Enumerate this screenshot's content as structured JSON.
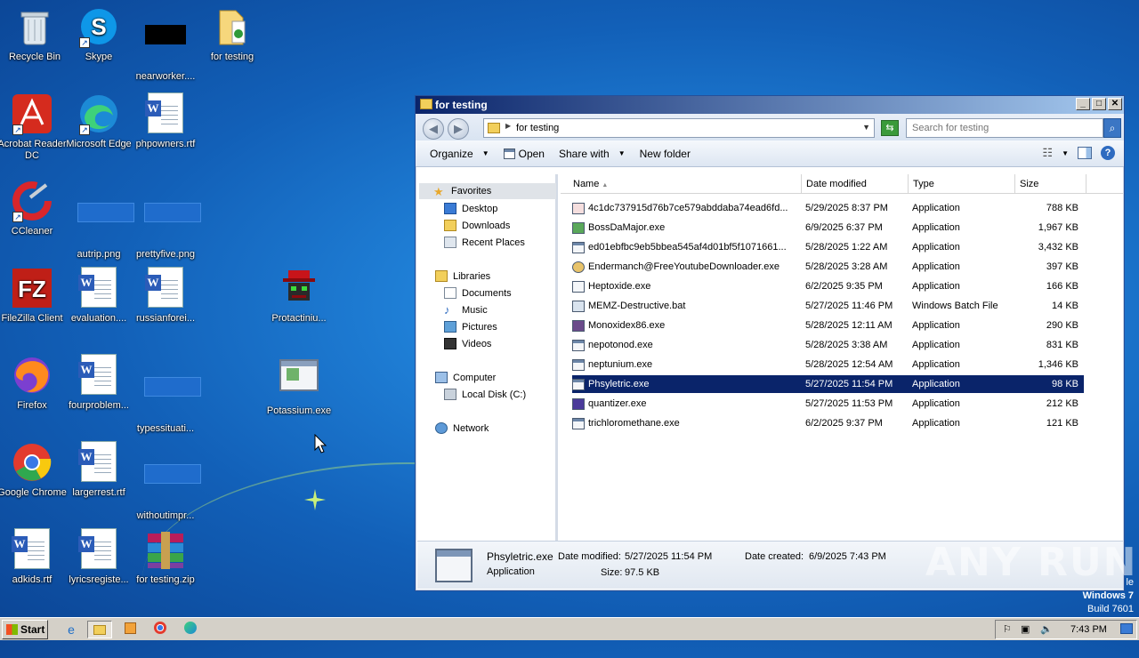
{
  "desktop": {
    "icons": [
      {
        "label": "Recycle Bin"
      },
      {
        "label": "Skype"
      },
      {
        "label": "nearworker...."
      },
      {
        "label": "for testing"
      },
      {
        "label": "Acrobat Reader DC"
      },
      {
        "label": "Microsoft Edge"
      },
      {
        "label": "phpowners.rtf"
      },
      {
        "label": "CCleaner"
      },
      {
        "label": "autrip.png"
      },
      {
        "label": "prettyfive.png"
      },
      {
        "label": "FileZilla Client"
      },
      {
        "label": "evaluation...."
      },
      {
        "label": "russianforei..."
      },
      {
        "label": "Protactiniu..."
      },
      {
        "label": "Firefox"
      },
      {
        "label": "fourproblem..."
      },
      {
        "label": "typessituati..."
      },
      {
        "label": "Potassium.exe"
      },
      {
        "label": "Google Chrome"
      },
      {
        "label": "largerrest.rtf"
      },
      {
        "label": "withoutimpr..."
      },
      {
        "label": "adkids.rtf"
      },
      {
        "label": "lyricsregiste..."
      },
      {
        "label": "for testing.zip"
      }
    ]
  },
  "window": {
    "title": "for testing",
    "address": "for testing",
    "search_placeholder": "Search for testing",
    "toolbar": {
      "organize": "Organize",
      "open": "Open",
      "share": "Share with",
      "new_folder": "New folder"
    },
    "nav": {
      "favorites": "Favorites",
      "desktop": "Desktop",
      "downloads": "Downloads",
      "recent": "Recent Places",
      "libraries": "Libraries",
      "documents": "Documents",
      "music": "Music",
      "pictures": "Pictures",
      "videos": "Videos",
      "computer": "Computer",
      "local_disk": "Local Disk (C:)",
      "network": "Network"
    },
    "columns": {
      "name": "Name",
      "date": "Date modified",
      "type": "Type",
      "size": "Size"
    },
    "files": [
      {
        "name": "4c1dc737915d76b7ce579abddaba74ead6fd...",
        "date": "5/29/2025 8:37 PM",
        "type": "Application",
        "size": "788 KB"
      },
      {
        "name": "BossDaMajor.exe",
        "date": "6/9/2025 6:37 PM",
        "type": "Application",
        "size": "1,967 KB"
      },
      {
        "name": "ed01ebfbc9eb5bbea545af4d01bf5f1071661...",
        "date": "5/28/2025 1:22 AM",
        "type": "Application",
        "size": "3,432 KB"
      },
      {
        "name": "Endermanch@FreeYoutubeDownloader.exe",
        "date": "5/28/2025 3:28 AM",
        "type": "Application",
        "size": "397 KB"
      },
      {
        "name": "Heptoxide.exe",
        "date": "6/2/2025 9:35 PM",
        "type": "Application",
        "size": "166 KB"
      },
      {
        "name": "MEMZ-Destructive.bat",
        "date": "5/27/2025 11:46 PM",
        "type": "Windows Batch File",
        "size": "14 KB"
      },
      {
        "name": "Monoxidex86.exe",
        "date": "5/28/2025 12:11 AM",
        "type": "Application",
        "size": "290 KB"
      },
      {
        "name": "nepotonod.exe",
        "date": "5/28/2025 3:38 AM",
        "type": "Application",
        "size": "831 KB"
      },
      {
        "name": "neptunium.exe",
        "date": "5/28/2025 12:54 AM",
        "type": "Application",
        "size": "1,346 KB"
      },
      {
        "name": "Phsyletric.exe",
        "date": "5/27/2025 11:54 PM",
        "type": "Application",
        "size": "98 KB"
      },
      {
        "name": "quantizer.exe",
        "date": "5/27/2025 11:53 PM",
        "type": "Application",
        "size": "212 KB"
      },
      {
        "name": "trichloromethane.exe",
        "date": "6/2/2025 9:37 PM",
        "type": "Application",
        "size": "121 KB"
      }
    ],
    "details": {
      "name": "Phsyletric.exe",
      "kind": "Application",
      "modified_label": "Date modified:",
      "modified": "5/27/2025 11:54 PM",
      "size_label": "Size:",
      "size": "97.5 KB",
      "created_label": "Date created:",
      "created": "6/9/2025 7:43 PM"
    }
  },
  "taskbar": {
    "start": "Start",
    "time": "7:43 PM"
  },
  "watermark": {
    "line1": "Windows 7",
    "line2": "Build 7601",
    "partial": "le",
    "brand": "ANY RUN"
  }
}
